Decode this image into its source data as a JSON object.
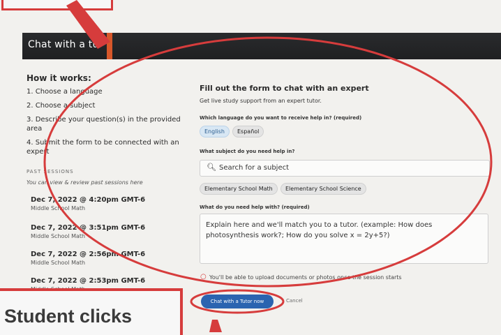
{
  "header": {
    "title": "Chat with a tu"
  },
  "how_it_works": {
    "title": "How it works:",
    "steps": [
      "1. Choose a language",
      "2. Choose a subject",
      "3. Describe your question(s) in the provided area",
      "4. Submit the form to be connected with an expert"
    ]
  },
  "past_sessions": {
    "label": "PAST SESSIONS",
    "description": "You can view & review past sessions here",
    "items": [
      {
        "datetime": "Dec 7, 2022 @ 4:20pm GMT-6",
        "subject": "Middle School Math"
      },
      {
        "datetime": "Dec 7, 2022 @ 3:51pm GMT-6",
        "subject": "Middle School Math"
      },
      {
        "datetime": "Dec 7, 2022 @ 2:56pm GMT-6",
        "subject": "Middle School Math"
      },
      {
        "datetime": "Dec 7, 2022 @ 2:53pm GMT-6",
        "subject": "Middle School Math"
      }
    ]
  },
  "form": {
    "title": "Fill out the form to chat with an expert",
    "subtitle": "Get live study support from an expert tutor.",
    "language_question": "Which language do you want to receive help in? (required)",
    "languages": [
      "English",
      "Español"
    ],
    "selected_language": "English",
    "subject_question": "What subject do you need help in?",
    "search_placeholder": "Search for a subject",
    "subject_chips": [
      "Elementary School Math",
      "Elementary School Science"
    ],
    "help_question": "What do you need help with? (required)",
    "help_placeholder": "Explain here and we'll match you to a tutor. (example: How does photosynthesis work?; How do you solve x = 2y+5?)",
    "upload_note": "You'll be able to upload documents or photos once the session starts",
    "submit_label": "Chat with a Tutor now",
    "cancel_label": "Cancel"
  },
  "annotations": {
    "bottom_callout": "Student clicks"
  },
  "colors": {
    "accent": "#d63c3c",
    "header": "#222325",
    "button": "#2b64b0"
  }
}
